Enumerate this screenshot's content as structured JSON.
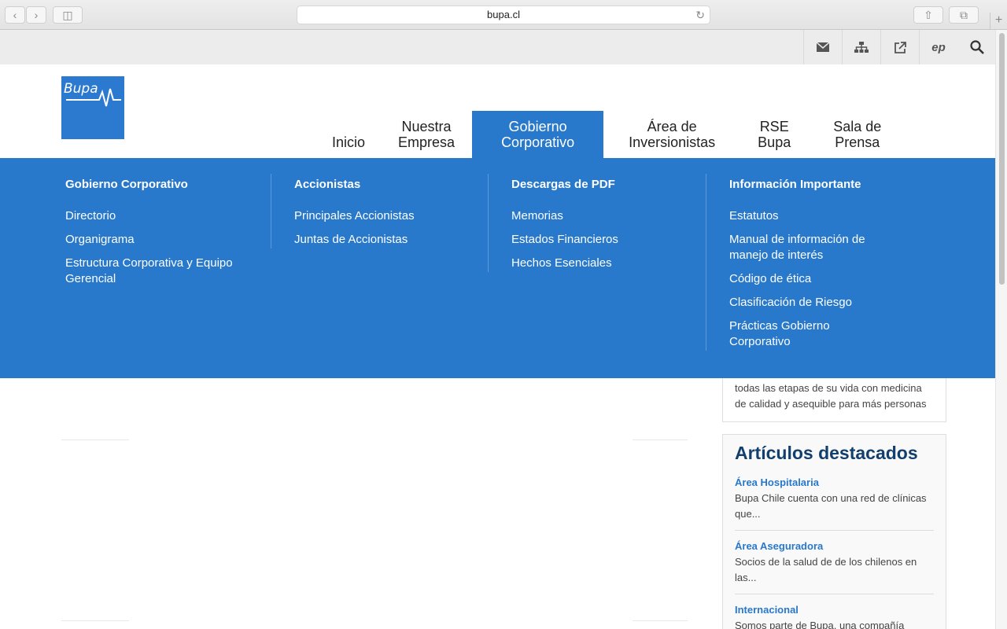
{
  "browser": {
    "url": "bupa.cl"
  },
  "utility_icons": [
    "mail-icon",
    "sitemap-icon",
    "external-link-icon",
    "ep-icon",
    "search-icon"
  ],
  "logo": {
    "text": "Bupa"
  },
  "nav": [
    {
      "label_line1": "",
      "label_line2": "Inicio"
    },
    {
      "label_line1": "Nuestra",
      "label_line2": "Empresa"
    },
    {
      "label_line1": "Gobierno",
      "label_line2": "Corporativo"
    },
    {
      "label_line1": "Área de",
      "label_line2": "Inversionistas"
    },
    {
      "label_line1": "RSE",
      "label_line2": "Bupa"
    },
    {
      "label_line1": "Sala de",
      "label_line2": "Prensa"
    }
  ],
  "mega": {
    "col1": {
      "title": "Gobierno Corporativo",
      "links": [
        "Directorio",
        "Organigrama",
        "Estructura Corporativa y Equipo Gerencial"
      ]
    },
    "col2": {
      "title": "Accionistas",
      "links": [
        "Principales Accionistas",
        "Juntas de Accionistas"
      ]
    },
    "col3": {
      "title": "Descargas de PDF",
      "links": [
        "Memorias",
        "Estados Financieros",
        "Hechos Esenciales"
      ]
    },
    "col4": {
      "title": "Información Importante",
      "links": [
        "Estatutos",
        "Manual de información de manejo de interés",
        "Código de ética",
        "Clasificación de Riesgo",
        "Prácticas Gobierno Corporativo"
      ]
    }
  },
  "intro_text": "todas las etapas de su vida con medicina de calidad y asequible para más personas",
  "featured": {
    "title": "Artículos destacados",
    "articles": [
      {
        "title": "Área Hospitalaria",
        "text": "Bupa Chile cuenta con una red de clínicas que..."
      },
      {
        "title": "Área Aseguradora",
        "text": "Socios de la salud de de los chilenos en las..."
      },
      {
        "title": "Internacional",
        "text": "Somos parte de Bupa, una compañía"
      }
    ]
  },
  "colors": {
    "brand_blue": "#2878cb",
    "heading_navy": "#123f6d"
  }
}
